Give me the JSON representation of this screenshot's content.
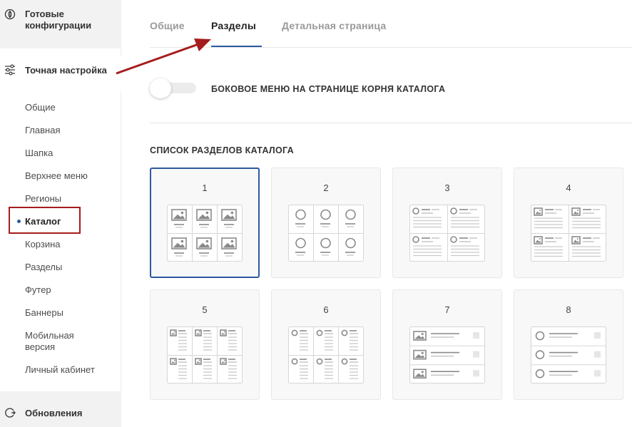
{
  "sidebar": {
    "ready_configs": "Готовые конфигурации",
    "fine_tuning": "Точная настройка",
    "items": [
      {
        "label": "Общие"
      },
      {
        "label": "Главная"
      },
      {
        "label": "Шапка"
      },
      {
        "label": "Верхнее меню"
      },
      {
        "label": "Регионы"
      },
      {
        "label": "Каталог",
        "active": true
      },
      {
        "label": "Корзина"
      },
      {
        "label": "Разделы"
      },
      {
        "label": "Футер"
      },
      {
        "label": "Баннеры"
      },
      {
        "label": "Мобильная версия"
      },
      {
        "label": "Личный кабинет"
      }
    ],
    "updates": "Обновления"
  },
  "tabs": [
    {
      "label": "Общие"
    },
    {
      "label": "Разделы",
      "active": true
    },
    {
      "label": "Детальная страница"
    }
  ],
  "side_menu_toggle": {
    "label": "БОКОВОЕ МЕНЮ НА СТРАНИЦЕ КОРНЯ КАТАЛОГА",
    "on": false
  },
  "section_list": {
    "title": "СПИСОК РАЗДЕЛОВ КАТАЛОГА",
    "options": [
      {
        "number": "1",
        "layout": "grid-images",
        "selected": true
      },
      {
        "number": "2",
        "layout": "grid-circles"
      },
      {
        "number": "3",
        "layout": "grid-circles-text"
      },
      {
        "number": "4",
        "layout": "grid-images-text"
      },
      {
        "number": "5",
        "layout": "grid-small-images-list"
      },
      {
        "number": "6",
        "layout": "grid-small-circles-list"
      },
      {
        "number": "7",
        "layout": "list-images"
      },
      {
        "number": "8",
        "layout": "list-circles"
      }
    ]
  },
  "colors": {
    "accent": "#2c5aa0",
    "highlight_box": "#a51c1c",
    "arrow": "#a51c1c"
  }
}
